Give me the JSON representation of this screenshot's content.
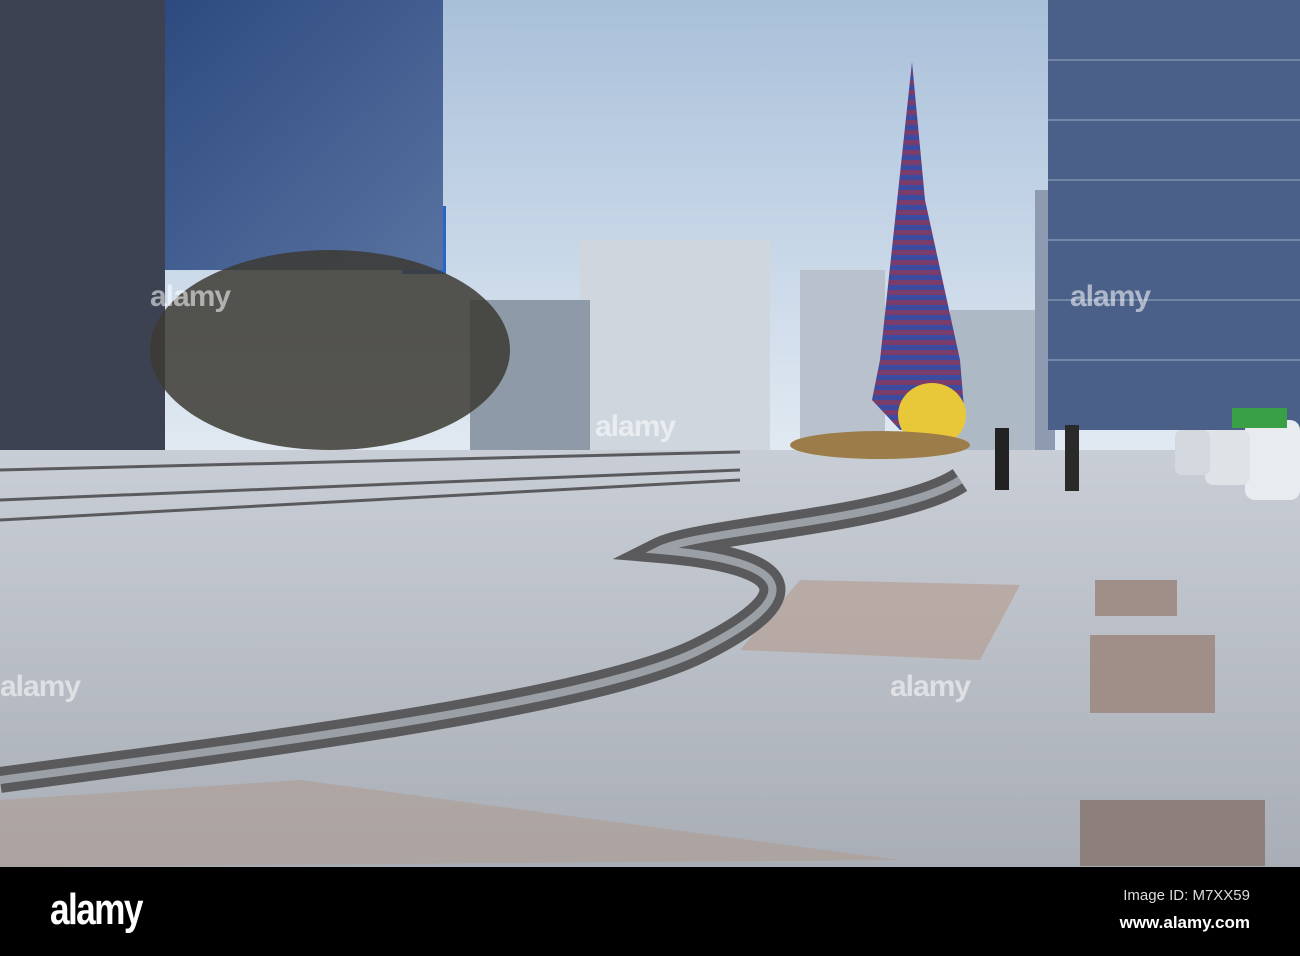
{
  "photo": {
    "subject": "Plaza with tall spiral sculpture, curving stream and city buildings"
  },
  "watermark": {
    "text": "alamy"
  },
  "footer": {
    "logo": "alamy",
    "image_id": "Image ID: M7XX59",
    "website": "www.alamy.com"
  }
}
